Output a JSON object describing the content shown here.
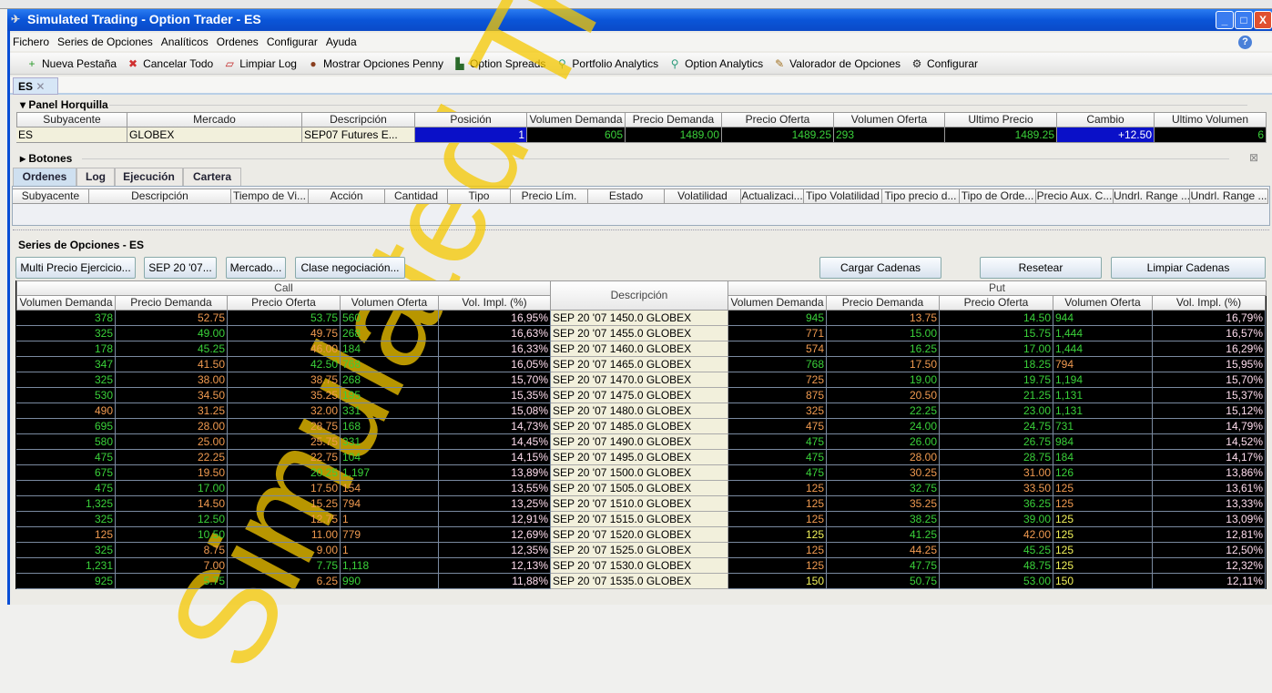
{
  "window": {
    "title": "Simulated Trading - Option Trader - ES",
    "minimize": "_",
    "maximize": "□",
    "close": "X"
  },
  "menu": [
    "Fichero",
    "Series de Opciones",
    "Analíticos",
    "Ordenes",
    "Configurar",
    "Ayuda"
  ],
  "toolbar": [
    {
      "label": "Nueva Pestaña",
      "icon": "new-tab-icon",
      "glyph": "+",
      "color": "#2a9a2a"
    },
    {
      "label": "Cancelar Todo",
      "icon": "cancel-all-icon",
      "glyph": "✖",
      "color": "#d03030"
    },
    {
      "label": "Limpiar Log",
      "icon": "clear-log-icon",
      "glyph": "▱",
      "color": "#c02020"
    },
    {
      "label": "Mostrar Opciones Penny",
      "icon": "penny-icon",
      "glyph": "●",
      "color": "#8a4020"
    },
    {
      "label": "Option Spreads",
      "icon": "spreads-icon",
      "glyph": "▙",
      "color": "#2a6a2a"
    },
    {
      "label": "Portfolio Analytics",
      "icon": "magnifier-icon",
      "glyph": "⚲",
      "color": "#2a9a7a"
    },
    {
      "label": "Option Analytics",
      "icon": "magnifier-icon",
      "glyph": "⚲",
      "color": "#2a9a7a"
    },
    {
      "label": "Valorador de Opciones",
      "icon": "chart-pen-icon",
      "glyph": "✎",
      "color": "#a07020"
    },
    {
      "label": "Configurar",
      "icon": "gear-icon",
      "glyph": "⚙",
      "color": "#222"
    }
  ],
  "tab": {
    "label": "ES"
  },
  "panel_horquilla": {
    "title": "Panel Horquilla",
    "headers": [
      "Subyacente",
      "Mercado",
      "Descripción",
      "Posición",
      "Volumen Demanda",
      "Precio Demanda",
      "Precio Oferta",
      "Volumen Oferta",
      "Ultimo Precio",
      "Cambio",
      "Ultimo Volumen"
    ],
    "row": [
      "ES",
      "GLOBEX",
      "SEP07 Futures E...",
      "1",
      "605",
      "1489.00",
      "1489.25",
      "293",
      "1489.25",
      "+12.50",
      "6"
    ]
  },
  "botones": {
    "title": "Botones"
  },
  "orders": {
    "tabs": [
      "Ordenes",
      "Log",
      "Ejecución",
      "Cartera"
    ],
    "headers": [
      "Subyacente",
      "Descripción",
      "Tiempo de Vi...",
      "Acción",
      "Cantidad",
      "Tipo",
      "Precio Lím.",
      "Estado",
      "Volatilidad",
      "Actualizaci...",
      "Tipo Volatilidad",
      "Tipo precio d...",
      "Tipo de Orde...",
      "Precio Aux. C...",
      "Undrl. Range ...",
      "Undrl. Range ..."
    ]
  },
  "series": {
    "title": "Series de Opciones - ES",
    "buttons_left": [
      "Multi Precio Ejercicio...",
      "SEP 20 '07...",
      "Mercado...",
      "Clase negociación..."
    ],
    "buttons_right": [
      "Cargar Cadenas",
      "Resetear",
      "Limpiar Cadenas"
    ],
    "call_label": "Call",
    "put_label": "Put",
    "desc_label": "Descripción",
    "col_headers": [
      "Volumen Demanda",
      "Precio Demanda",
      "Precio Oferta",
      "Volumen Oferta",
      "Vol. Impl. (%)"
    ],
    "rows": [
      {
        "desc": "SEP 20 '07 1450.0 GLOBEX",
        "call": [
          [
            "378",
            "g"
          ],
          [
            "52.75",
            "o"
          ],
          [
            "53.75",
            "g"
          ],
          [
            "560",
            "g"
          ],
          [
            "16,95%",
            "w"
          ]
        ],
        "put": [
          [
            "945",
            "g"
          ],
          [
            "13.75",
            "o"
          ],
          [
            "14.50",
            "g"
          ],
          [
            "944",
            "g"
          ],
          [
            "16,79%",
            "w"
          ]
        ]
      },
      {
        "desc": "SEP 20 '07 1455.0 GLOBEX",
        "call": [
          [
            "325",
            "g"
          ],
          [
            "49.00",
            "g"
          ],
          [
            "49.75",
            "o"
          ],
          [
            "268",
            "g"
          ],
          [
            "16,63%",
            "w"
          ]
        ],
        "put": [
          [
            "771",
            "o"
          ],
          [
            "15.00",
            "g"
          ],
          [
            "15.75",
            "g"
          ],
          [
            "1,444",
            "g"
          ],
          [
            "16,57%",
            "w"
          ]
        ]
      },
      {
        "desc": "SEP 20 '07 1460.0 GLOBEX",
        "call": [
          [
            "178",
            "g"
          ],
          [
            "45.25",
            "g"
          ],
          [
            "46.00",
            "o"
          ],
          [
            "184",
            "g"
          ],
          [
            "16,33%",
            "w"
          ]
        ],
        "put": [
          [
            "574",
            "o"
          ],
          [
            "16.25",
            "g"
          ],
          [
            "17.00",
            "g"
          ],
          [
            "1,444",
            "g"
          ],
          [
            "16,29%",
            "w"
          ]
        ]
      },
      {
        "desc": "SEP 20 '07 1465.0 GLOBEX",
        "call": [
          [
            "347",
            "g"
          ],
          [
            "41.50",
            "o"
          ],
          [
            "42.50",
            "g"
          ],
          [
            "768",
            "g"
          ],
          [
            "16,05%",
            "w"
          ]
        ],
        "put": [
          [
            "768",
            "g"
          ],
          [
            "17.50",
            "o"
          ],
          [
            "18.25",
            "g"
          ],
          [
            "794",
            "o"
          ],
          [
            "15,95%",
            "w"
          ]
        ]
      },
      {
        "desc": "SEP 20 '07 1470.0 GLOBEX",
        "call": [
          [
            "325",
            "g"
          ],
          [
            "38.00",
            "o"
          ],
          [
            "38.75",
            "o"
          ],
          [
            "268",
            "g"
          ],
          [
            "15,70%",
            "w"
          ]
        ],
        "put": [
          [
            "725",
            "o"
          ],
          [
            "19.00",
            "g"
          ],
          [
            "19.75",
            "g"
          ],
          [
            "1,194",
            "g"
          ],
          [
            "15,70%",
            "w"
          ]
        ]
      },
      {
        "desc": "SEP 20 '07 1475.0 GLOBEX",
        "call": [
          [
            "530",
            "g"
          ],
          [
            "34.50",
            "o"
          ],
          [
            "35.25",
            "o"
          ],
          [
            "195",
            "g"
          ],
          [
            "15,35%",
            "w"
          ]
        ],
        "put": [
          [
            "875",
            "o"
          ],
          [
            "20.50",
            "o"
          ],
          [
            "21.25",
            "g"
          ],
          [
            "1,131",
            "g"
          ],
          [
            "15,37%",
            "w"
          ]
        ]
      },
      {
        "desc": "SEP 20 '07 1480.0 GLOBEX",
        "call": [
          [
            "490",
            "o"
          ],
          [
            "31.25",
            "o"
          ],
          [
            "32.00",
            "o"
          ],
          [
            "331",
            "g"
          ],
          [
            "15,08%",
            "w"
          ]
        ],
        "put": [
          [
            "325",
            "o"
          ],
          [
            "22.25",
            "g"
          ],
          [
            "23.00",
            "g"
          ],
          [
            "1,131",
            "g"
          ],
          [
            "15,12%",
            "w"
          ]
        ]
      },
      {
        "desc": "SEP 20 '07 1485.0 GLOBEX",
        "call": [
          [
            "695",
            "g"
          ],
          [
            "28.00",
            "o"
          ],
          [
            "28.75",
            "o"
          ],
          [
            "168",
            "g"
          ],
          [
            "14,73%",
            "w"
          ]
        ],
        "put": [
          [
            "475",
            "o"
          ],
          [
            "24.00",
            "g"
          ],
          [
            "24.75",
            "g"
          ],
          [
            "731",
            "g"
          ],
          [
            "14,79%",
            "w"
          ]
        ]
      },
      {
        "desc": "SEP 20 '07 1490.0 GLOBEX",
        "call": [
          [
            "580",
            "g"
          ],
          [
            "25.00",
            "o"
          ],
          [
            "25.75",
            "o"
          ],
          [
            "331",
            "g"
          ],
          [
            "14,45%",
            "w"
          ]
        ],
        "put": [
          [
            "475",
            "g"
          ],
          [
            "26.00",
            "g"
          ],
          [
            "26.75",
            "g"
          ],
          [
            "984",
            "g"
          ],
          [
            "14,52%",
            "w"
          ]
        ]
      },
      {
        "desc": "SEP 20 '07 1495.0 GLOBEX",
        "call": [
          [
            "475",
            "g"
          ],
          [
            "22.25",
            "o"
          ],
          [
            "22.75",
            "o"
          ],
          [
            "104",
            "g"
          ],
          [
            "14,15%",
            "w"
          ]
        ],
        "put": [
          [
            "475",
            "g"
          ],
          [
            "28.00",
            "o"
          ],
          [
            "28.75",
            "g"
          ],
          [
            "184",
            "g"
          ],
          [
            "14,17%",
            "w"
          ]
        ]
      },
      {
        "desc": "SEP 20 '07 1500.0 GLOBEX",
        "call": [
          [
            "675",
            "g"
          ],
          [
            "19.50",
            "o"
          ],
          [
            "20.25",
            "g"
          ],
          [
            "1,197",
            "g"
          ],
          [
            "13,89%",
            "w"
          ]
        ],
        "put": [
          [
            "475",
            "g"
          ],
          [
            "30.25",
            "o"
          ],
          [
            "31.00",
            "o"
          ],
          [
            "126",
            "g"
          ],
          [
            "13,86%",
            "w"
          ]
        ]
      },
      {
        "desc": "SEP 20 '07 1505.0 GLOBEX",
        "call": [
          [
            "475",
            "g"
          ],
          [
            "17.00",
            "g"
          ],
          [
            "17.50",
            "o"
          ],
          [
            "154",
            "o"
          ],
          [
            "13,55%",
            "w"
          ]
        ],
        "put": [
          [
            "125",
            "o"
          ],
          [
            "32.75",
            "g"
          ],
          [
            "33.50",
            "o"
          ],
          [
            "125",
            "o"
          ],
          [
            "13,61%",
            "w"
          ]
        ]
      },
      {
        "desc": "SEP 20 '07 1510.0 GLOBEX",
        "call": [
          [
            "1,325",
            "g"
          ],
          [
            "14.50",
            "o"
          ],
          [
            "15.25",
            "o"
          ],
          [
            "794",
            "o"
          ],
          [
            "13,25%",
            "w"
          ]
        ],
        "put": [
          [
            "125",
            "o"
          ],
          [
            "35.25",
            "o"
          ],
          [
            "36.25",
            "g"
          ],
          [
            "125",
            "o"
          ],
          [
            "13,33%",
            "w"
          ]
        ]
      },
      {
        "desc": "SEP 20 '07 1515.0 GLOBEX",
        "call": [
          [
            "325",
            "g"
          ],
          [
            "12.50",
            "g"
          ],
          [
            "12.75",
            "o"
          ],
          [
            "1",
            "o"
          ],
          [
            "12,91%",
            "w"
          ]
        ],
        "put": [
          [
            "125",
            "o"
          ],
          [
            "38.25",
            "g"
          ],
          [
            "39.00",
            "g"
          ],
          [
            "125",
            "y"
          ],
          [
            "13,09%",
            "w"
          ]
        ]
      },
      {
        "desc": "SEP 20 '07 1520.0 GLOBEX",
        "call": [
          [
            "125",
            "o"
          ],
          [
            "10.50",
            "g"
          ],
          [
            "11.00",
            "o"
          ],
          [
            "779",
            "o"
          ],
          [
            "12,69%",
            "w"
          ]
        ],
        "put": [
          [
            "125",
            "y"
          ],
          [
            "41.25",
            "g"
          ],
          [
            "42.00",
            "o"
          ],
          [
            "125",
            "y"
          ],
          [
            "12,81%",
            "w"
          ]
        ]
      },
      {
        "desc": "SEP 20 '07 1525.0 GLOBEX",
        "call": [
          [
            "325",
            "g"
          ],
          [
            "8.75",
            "o"
          ],
          [
            "9.00",
            "o"
          ],
          [
            "1",
            "o"
          ],
          [
            "12,35%",
            "w"
          ]
        ],
        "put": [
          [
            "125",
            "o"
          ],
          [
            "44.25",
            "o"
          ],
          [
            "45.25",
            "g"
          ],
          [
            "125",
            "y"
          ],
          [
            "12,50%",
            "w"
          ]
        ]
      },
      {
        "desc": "SEP 20 '07 1530.0 GLOBEX",
        "call": [
          [
            "1,231",
            "g"
          ],
          [
            "7.00",
            "o"
          ],
          [
            "7.75",
            "g"
          ],
          [
            "1,118",
            "g"
          ],
          [
            "12,13%",
            "w"
          ]
        ],
        "put": [
          [
            "125",
            "o"
          ],
          [
            "47.75",
            "g"
          ],
          [
            "48.75",
            "g"
          ],
          [
            "125",
            "y"
          ],
          [
            "12,32%",
            "w"
          ]
        ]
      },
      {
        "desc": "SEP 20 '07 1535.0 GLOBEX",
        "call": [
          [
            "925",
            "g"
          ],
          [
            "5.75",
            "g"
          ],
          [
            "6.25",
            "o"
          ],
          [
            "990",
            "g"
          ],
          [
            "11,88%",
            "w"
          ]
        ],
        "put": [
          [
            "150",
            "y"
          ],
          [
            "50.75",
            "g"
          ],
          [
            "53.00",
            "g"
          ],
          [
            "150",
            "y"
          ],
          [
            "12,11%",
            "w"
          ]
        ]
      }
    ]
  },
  "watermark": "Simulated Trading"
}
